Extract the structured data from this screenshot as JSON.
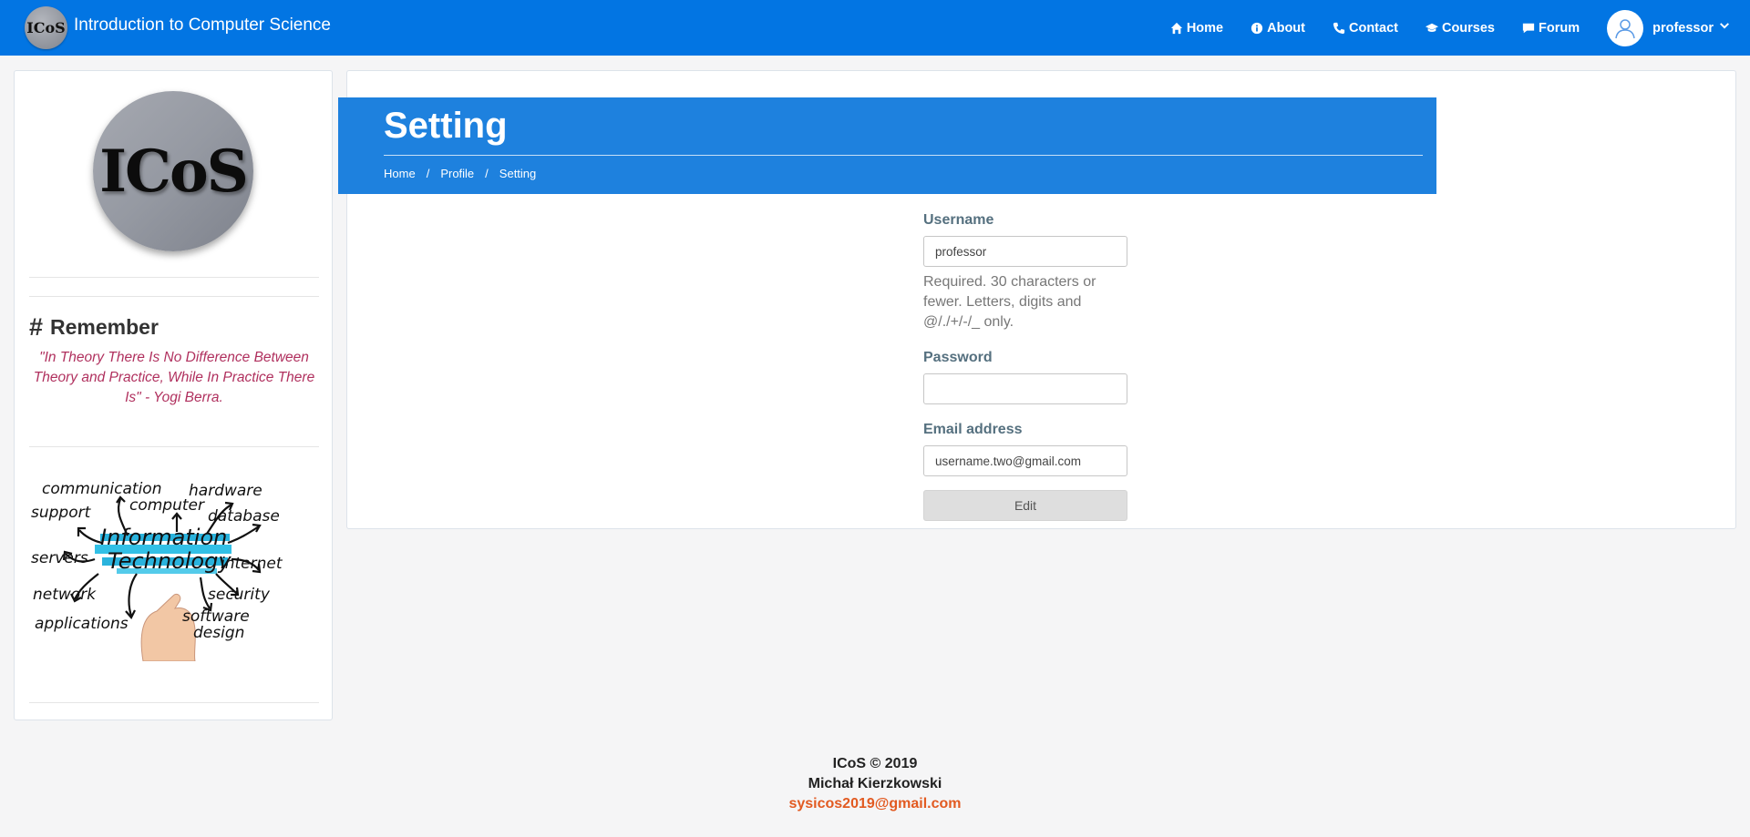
{
  "navbar": {
    "brand_logo_text": "ICoS",
    "brand_title": "Introduction to Computer Science",
    "links": [
      {
        "label": "Home",
        "icon": "home-icon"
      },
      {
        "label": "About",
        "icon": "info-icon"
      },
      {
        "label": "Contact",
        "icon": "phone-icon"
      },
      {
        "label": "Courses",
        "icon": "graduation-cap-icon"
      },
      {
        "label": "Forum",
        "icon": "comment-icon"
      }
    ],
    "user": {
      "name": "professor",
      "icon": "user-avatar-icon"
    },
    "color": "#0275e3"
  },
  "sidebar": {
    "logo_text": "ICoS",
    "remember_title": "Remember",
    "quote": "\"In Theory There Is No Difference Between Theory and Practice, While In Practice There Is\" - Yogi Berra.",
    "image_words": [
      "communication",
      "hardware",
      "support",
      "computer",
      "database",
      "Information",
      "Technology",
      "servers",
      "internet",
      "network",
      "security",
      "applications",
      "software",
      "design"
    ]
  },
  "main": {
    "page_title": "Setting",
    "breadcrumb": [
      "Home",
      "Profile",
      "Setting"
    ],
    "header_color": "#1e81de",
    "form": {
      "username_label": "Username",
      "username_value": "professor",
      "username_help": "Required. 30 characters or fewer. Letters, digits and @/./+/-/_ only.",
      "password_label": "Password",
      "password_value": "",
      "email_label": "Email address",
      "email_value": "username.two@gmail.com",
      "submit_label": "Edit"
    }
  },
  "footer": {
    "copyright": "ICoS © 2019",
    "author": "Michał Kierzkowski",
    "email": "sysicos2019@gmail.com"
  }
}
